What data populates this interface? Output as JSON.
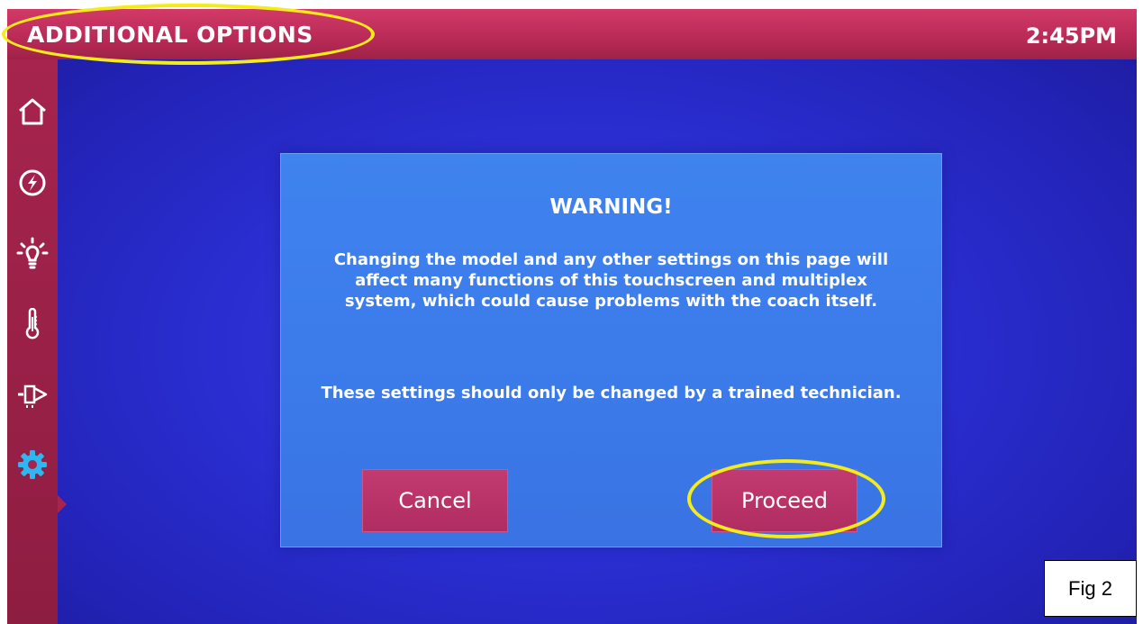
{
  "header": {
    "title": "ADDITIONAL OPTIONS",
    "time": "2:45PM"
  },
  "sidebar": {
    "items": [
      {
        "id": "home",
        "icon": "home-icon",
        "active": false
      },
      {
        "id": "power",
        "icon": "power-lightning-icon",
        "active": false
      },
      {
        "id": "lights",
        "icon": "light-bulb-icon",
        "active": false
      },
      {
        "id": "climate",
        "icon": "thermometer-icon",
        "active": false
      },
      {
        "id": "slides",
        "icon": "slide-out-icon",
        "active": false
      },
      {
        "id": "settings",
        "icon": "gear-icon",
        "active": true
      }
    ]
  },
  "dialog": {
    "title": "WARNING!",
    "message": "Changing the model and any other settings on this page will affect many functions of this touchscreen and multiplex system, which could cause problems with the coach itself.",
    "note": "These settings should only be changed by a trained technician.",
    "cancel_label": "Cancel",
    "proceed_label": "Proceed"
  },
  "figure_label": "Fig 2",
  "colors": {
    "header_bar": "#b92a56",
    "sidebar": "#a6244e",
    "screen_background": "#2a2ed0",
    "dialog_background": "#3b7ae9",
    "button": "#b02d61",
    "active_icon": "#2fb6f0",
    "highlight_ring": "#f4ec1a"
  }
}
